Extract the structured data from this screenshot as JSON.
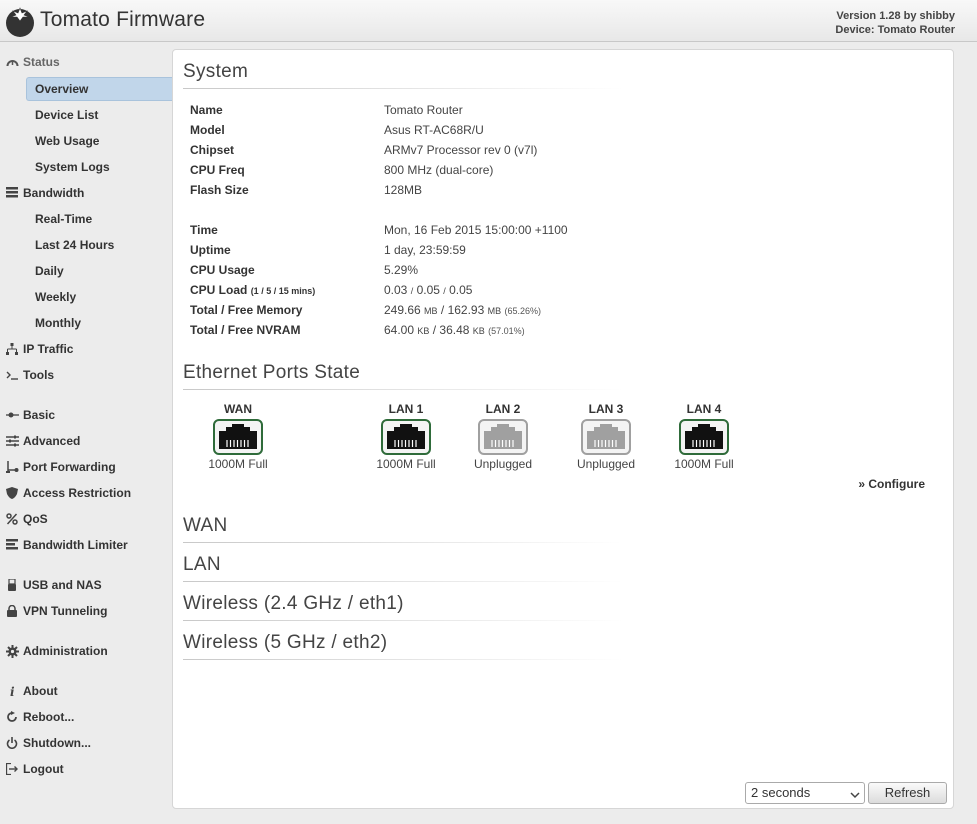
{
  "header": {
    "title": "Tomato Firmware",
    "version": "Version 1.28 by shibby",
    "device": "Device: Tomato Router"
  },
  "sidebar": {
    "status": "Status",
    "status_items": [
      "Overview",
      "Device List",
      "Web Usage",
      "System Logs"
    ],
    "bandwidth": "Bandwidth",
    "bandwidth_items": [
      "Real-Time",
      "Last 24 Hours",
      "Daily",
      "Weekly",
      "Monthly"
    ],
    "ip_traffic": "IP Traffic",
    "tools": "Tools",
    "basic": "Basic",
    "advanced": "Advanced",
    "port_forwarding": "Port Forwarding",
    "access_restriction": "Access Restriction",
    "qos": "QoS",
    "bandwidth_limiter": "Bandwidth Limiter",
    "usb_nas": "USB and NAS",
    "vpn": "VPN Tunneling",
    "administration": "Administration",
    "about": "About",
    "reboot": "Reboot...",
    "shutdown": "Shutdown...",
    "logout": "Logout"
  },
  "system": {
    "title": "System",
    "name_label": "Name",
    "name": "Tomato Router",
    "model_label": "Model",
    "model": "Asus RT-AC68R/U",
    "chipset_label": "Chipset",
    "chipset": "ARMv7 Processor rev 0 (v7l)",
    "cpufreq_label": "CPU Freq",
    "cpufreq": "800 MHz (dual-core)",
    "flash_label": "Flash Size",
    "flash": "128MB",
    "time_label": "Time",
    "time": "Mon, 16 Feb 2015 15:00:00 +1100",
    "uptime_label": "Uptime",
    "uptime": "1 day, 23:59:59",
    "cpuusage_label": "CPU Usage",
    "cpuusage": "5.29%",
    "cpuload_label": "CPU Load",
    "cpuload_hint": "(1 / 5 / 15 mins)",
    "cpuload_1": "0.03",
    "cpuload_5": "0.05",
    "cpuload_15": "0.05",
    "cpuload_sep": "/",
    "memory_label": "Total / Free Memory",
    "mem_total": "249.66",
    "mem_free": "162.93",
    "mem_unit": "MB",
    "mem_pct": "(65.26%)",
    "nvram_label": "Total / Free NVRAM",
    "nvram_total": "64.00",
    "nvram_free": "36.48",
    "nvram_unit": "KB",
    "nvram_pct": "(57.01%)",
    "slash": "/"
  },
  "ethernet": {
    "title": "Ethernet Ports State",
    "ports": [
      {
        "name": "WAN",
        "status": "1000M Full",
        "connected": true
      },
      {
        "name": "LAN 1",
        "status": "1000M Full",
        "connected": true
      },
      {
        "name": "LAN 2",
        "status": "Unplugged",
        "connected": false
      },
      {
        "name": "LAN 3",
        "status": "Unplugged",
        "connected": false
      },
      {
        "name": "LAN 4",
        "status": "1000M Full",
        "connected": true
      }
    ],
    "configure": "» Configure"
  },
  "sections": {
    "wan": "WAN",
    "lan": "LAN",
    "wireless24": "Wireless (2.4 GHz / eth1)",
    "wireless5": "Wireless (5 GHz / eth2)"
  },
  "refresh": {
    "interval": "2 seconds",
    "button": "Refresh"
  },
  "colors": {
    "active_nav_bg": "#c1d6ea",
    "port_connected_border": "#2f6b3a",
    "port_unplugged": "#a0a0a0"
  }
}
